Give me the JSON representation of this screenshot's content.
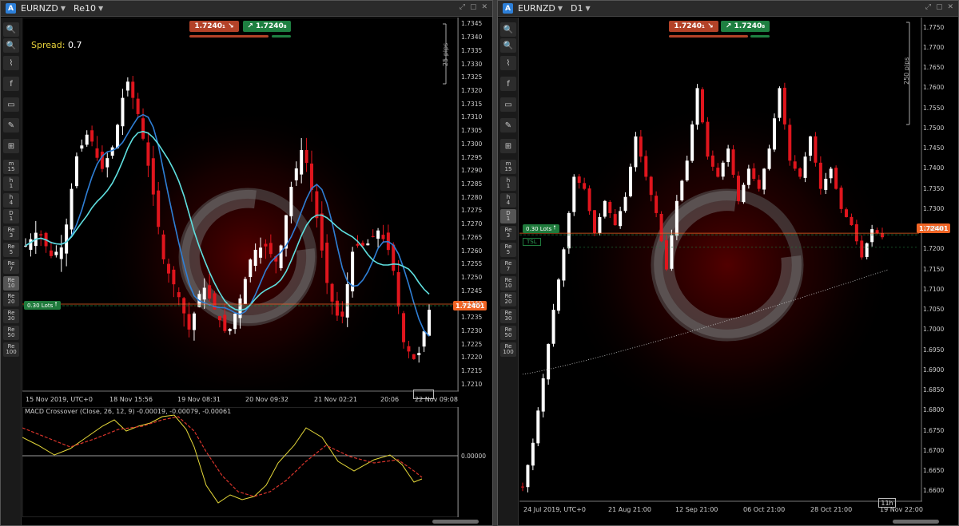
{
  "left": {
    "symbol": "EURNZD",
    "timeframe": "Re10",
    "spread_label": "Spread:",
    "spread_value": "0.7",
    "sell_price": "1.7240₁",
    "buy_price": "1.7240₈",
    "pips_label": "25 pips",
    "lots_label": "0.30 Lots",
    "current_price_tag": "1.72401",
    "macd_title": "MACD Crossover (Close, 26, 12, 9) -0.00019, -0.00079, -0.00061",
    "macd_zero": "0.00000",
    "y_ticks": [
      "1.7345",
      "1.7340",
      "1.7335",
      "1.7330",
      "1.7325",
      "1.7320",
      "1.7315",
      "1.7310",
      "1.7305",
      "1.7300",
      "1.7295",
      "1.7290",
      "1.7285",
      "1.7280",
      "1.7275",
      "1.7270",
      "1.7265",
      "1.7260",
      "1.7255",
      "1.7250",
      "1.7245",
      "1.7240",
      "1.7235",
      "1.7230",
      "1.7225",
      "1.7220",
      "1.7215",
      "1.7210"
    ],
    "x_ticks": [
      "15 Nov 2019, UTC+0",
      "18 Nov 15:56",
      "19 Nov 08:31",
      "20 Nov 09:32",
      "21 Nov 02:21",
      "20:06",
      "22 Nov 09:08"
    ]
  },
  "right": {
    "symbol": "EURNZD",
    "timeframe": "D1",
    "sell_price": "1.7240₁",
    "buy_price": "1.7240₈",
    "pips_label": "250 pips",
    "lots_label": "0.30 Lots",
    "current_price_tag": "1.72401",
    "tsl_label": "TSL",
    "timer": "11h",
    "y_ticks": [
      "1.7750",
      "1.7700",
      "1.7650",
      "1.7600",
      "1.7550",
      "1.7500",
      "1.7450",
      "1.7400",
      "1.7350",
      "1.7300",
      "1.7250",
      "1.7200",
      "1.7150",
      "1.7100",
      "1.7050",
      "1.7000",
      "1.6950",
      "1.6900",
      "1.6850",
      "1.6800",
      "1.6750",
      "1.6700",
      "1.6650",
      "1.6600"
    ],
    "x_ticks": [
      "24 Jul 2019, UTC+0",
      "21 Aug 21:00",
      "12 Sep 21:00",
      "06 Oct 21:00",
      "28 Oct 21:00",
      "19 Nov 22:00"
    ]
  },
  "toolbar": {
    "icons": [
      "zoom-in-icon",
      "zoom-out-icon",
      "chart-type-icon",
      "facebook-icon",
      "camera-icon",
      "drawing-icon",
      "indicator-icon"
    ],
    "timeframes": [
      [
        "m",
        "15"
      ],
      [
        "h",
        "1"
      ],
      [
        "h",
        "4"
      ],
      [
        "D",
        "1"
      ],
      [
        "Re",
        "3"
      ],
      [
        "Re",
        "5"
      ],
      [
        "Re",
        "7"
      ],
      [
        "Re",
        "10"
      ],
      [
        "Re",
        "20"
      ],
      [
        "Re",
        "30"
      ],
      [
        "Re",
        "50"
      ],
      [
        "Re",
        "100"
      ]
    ]
  },
  "colors": {
    "bull": "#ffffff",
    "bear": "#e0151d",
    "ma_fast": "#2f7fd6",
    "ma_slow": "#5fe0e0",
    "macd": "#e6d93a",
    "signal": "#d9342b",
    "price": "#f06424",
    "buy": "#1e7f41",
    "sell": "#b34228"
  }
}
